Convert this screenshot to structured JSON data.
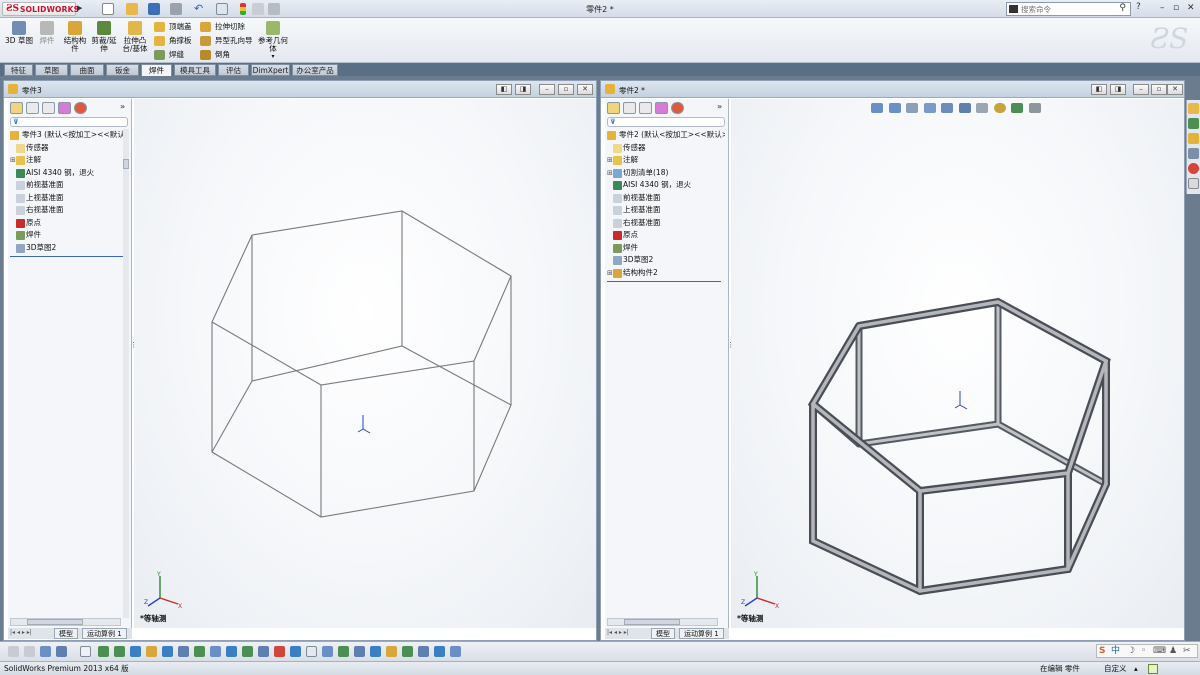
{
  "app": {
    "logo_text": "SOLIDWORKS",
    "document_title": "零件2 *",
    "command_search_placeholder": "搜索命令"
  },
  "ribbon": {
    "buttons": [
      {
        "label": "3D 草图"
      },
      {
        "label": "焊件"
      },
      {
        "label": "结构构件"
      },
      {
        "label": "剪裁/延伸"
      },
      {
        "label": "拉伸凸台/基体"
      },
      {
        "label": "参考几何体"
      }
    ],
    "small_buttons": [
      {
        "label": "顶端盖"
      },
      {
        "label": "角撑板"
      },
      {
        "label": "焊缝"
      },
      {
        "label": "拉伸切除"
      },
      {
        "label": "异型孔向导"
      },
      {
        "label": "倒角"
      }
    ]
  },
  "tabs": [
    {
      "label": "特征"
    },
    {
      "label": "草图"
    },
    {
      "label": "曲面"
    },
    {
      "label": "钣金"
    },
    {
      "label": "焊件",
      "active": true
    },
    {
      "label": "模具工具"
    },
    {
      "label": "评估"
    },
    {
      "label": "DimXpert"
    },
    {
      "label": "办公室产品"
    }
  ],
  "left_window": {
    "title": "零件3",
    "tree": [
      {
        "label": "零件3  (默认<按加工><<默认",
        "icon": "part-icon",
        "expander": "",
        "root": true
      },
      {
        "label": "传感器",
        "icon": "sensor-icon",
        "expander": ""
      },
      {
        "label": "注解",
        "icon": "annotation-icon",
        "expander": "+"
      },
      {
        "label": "AISI 4340 钢，退火",
        "icon": "material-icon",
        "expander": ""
      },
      {
        "label": "前视基准面",
        "icon": "plane-icon",
        "expander": ""
      },
      {
        "label": "上视基准面",
        "icon": "plane-icon",
        "expander": ""
      },
      {
        "label": "右视基准面",
        "icon": "plane-icon",
        "expander": ""
      },
      {
        "label": "原点",
        "icon": "origin-icon",
        "expander": ""
      },
      {
        "label": "焊件",
        "icon": "weldment-icon",
        "expander": ""
      },
      {
        "label": "3D草图2",
        "icon": "sketch-icon",
        "expander": ""
      }
    ],
    "view_label": "*等轴测",
    "bottom_tabs": [
      "模型",
      "运动算例 1"
    ]
  },
  "right_window": {
    "title": "零件2 *",
    "tree": [
      {
        "label": "零件2  (默认<按加工><<默认>",
        "icon": "part-icon",
        "expander": "",
        "root": true
      },
      {
        "label": "传感器",
        "icon": "sensor-icon",
        "expander": ""
      },
      {
        "label": "注解",
        "icon": "annotation-icon",
        "expander": "+"
      },
      {
        "label": "切割清单(18)",
        "icon": "cutlist-icon",
        "expander": "+"
      },
      {
        "label": "AISI 4340 钢，退火",
        "icon": "material-icon",
        "expander": ""
      },
      {
        "label": "前视基准面",
        "icon": "plane-icon",
        "expander": ""
      },
      {
        "label": "上视基准面",
        "icon": "plane-icon",
        "expander": ""
      },
      {
        "label": "右视基准面",
        "icon": "plane-icon",
        "expander": ""
      },
      {
        "label": "原点",
        "icon": "origin-icon",
        "expander": ""
      },
      {
        "label": "焊件",
        "icon": "weldment-icon",
        "expander": ""
      },
      {
        "label": "3D草图2",
        "icon": "sketch-icon",
        "expander": ""
      },
      {
        "label": "结构构件2",
        "icon": "structural-member-icon",
        "expander": "+"
      }
    ],
    "view_label": "*等轴测",
    "bottom_tabs": [
      "模型",
      "运动算例 1"
    ]
  },
  "status": {
    "version": "SolidWorks Premium 2013 x64 版",
    "editing": "在编辑 零件",
    "units": "自定义",
    "ime_text": "中"
  },
  "colors": {
    "brand_red": "#c8102e",
    "ribbon_bg": "#e4e9f0",
    "tab_bar_bg": "#5b6f84",
    "tree_selection_line": "#3a67b8",
    "beam_color": "#6f7276"
  }
}
